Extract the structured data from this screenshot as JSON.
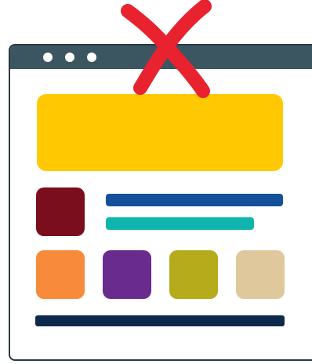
{
  "window": {
    "titlebar_color": "#3b5561",
    "dots": [
      "window-dot",
      "window-dot",
      "window-dot"
    ]
  },
  "icons": {
    "cross": "close-x-icon"
  },
  "colors": {
    "hero": "#ffc800",
    "avatar": "#7a0e1c",
    "line_primary": "#15509a",
    "line_secondary": "#0fb4ad",
    "tile_orange": "#f88a3c",
    "tile_purple": "#6a2b8f",
    "tile_olive": "#b5ab1b",
    "tile_sand": "#dfc99c",
    "footer_bar": "#0d2a4d",
    "cross": "#e8222e"
  }
}
